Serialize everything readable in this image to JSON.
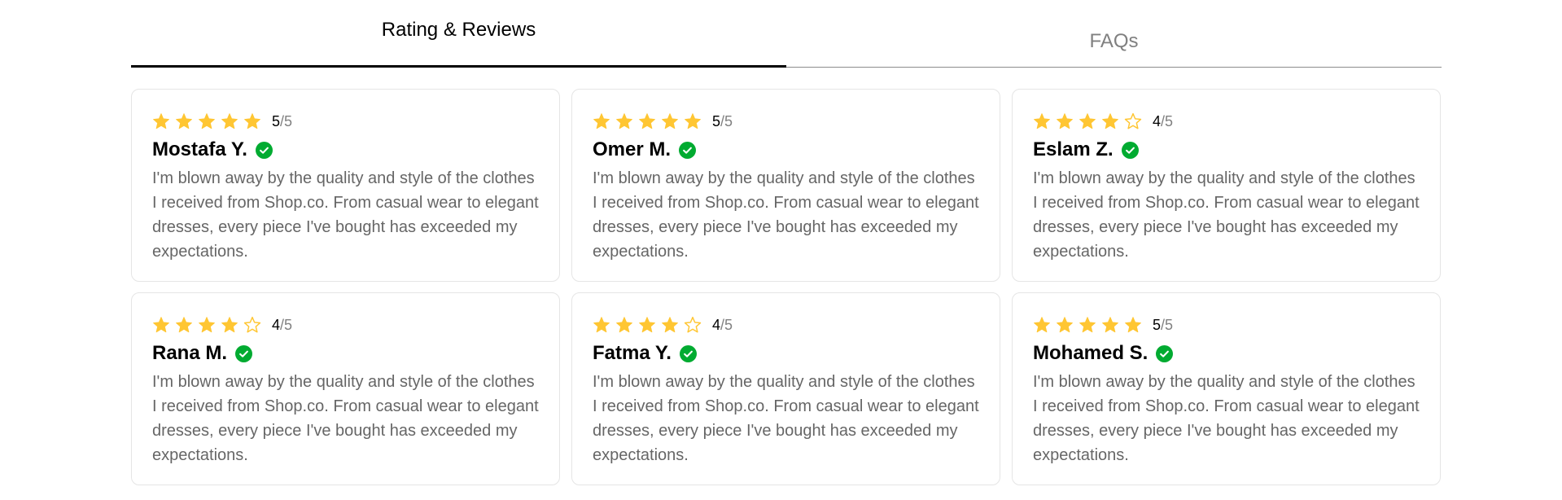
{
  "tabs": [
    {
      "label": "Rating & Reviews",
      "active": true
    },
    {
      "label": "FAQs",
      "active": false
    }
  ],
  "colors": {
    "star": "#FFC633",
    "verified": "#01AB31",
    "muted_text": "#666666"
  },
  "icons": {
    "star_filled": "star-icon",
    "star_empty": "star-outline-icon",
    "verified": "check-circle-icon"
  },
  "reviews": [
    {
      "rating": 5,
      "score": "5",
      "out_of": "/5",
      "name": "Mostafa Y.",
      "text": "I'm blown away by the quality and style of the clothes I received from Shop.co. From casual wear to elegant dresses, every piece I've bought has exceeded my expectations."
    },
    {
      "rating": 5,
      "score": "5",
      "out_of": "/5",
      "name": "Omer M.",
      "text": "I'm blown away by the quality and style of the clothes I received from Shop.co. From casual wear to elegant dresses, every piece I've bought has exceeded my expectations."
    },
    {
      "rating": 4,
      "score": "4",
      "out_of": "/5",
      "name": "Eslam Z.",
      "text": "I'm blown away by the quality and style of the clothes I received from Shop.co. From casual wear to elegant dresses, every piece I've bought has exceeded my expectations."
    },
    {
      "rating": 4,
      "score": "4",
      "out_of": "/5",
      "name": "Rana M.",
      "text": "I'm blown away by the quality and style of the clothes I received from Shop.co. From casual wear to elegant dresses, every piece I've bought has exceeded my expectations."
    },
    {
      "rating": 4,
      "score": "4",
      "out_of": "/5",
      "name": "Fatma Y.",
      "text": "I'm blown away by the quality and style of the clothes I received from Shop.co. From casual wear to elegant dresses, every piece I've bought has exceeded my expectations."
    },
    {
      "rating": 5,
      "score": "5",
      "out_of": "/5",
      "name": "Mohamed S.",
      "text": "I'm blown away by the quality and style of the clothes I received from Shop.co. From casual wear to elegant dresses, every piece I've bought has exceeded my expectations."
    }
  ]
}
